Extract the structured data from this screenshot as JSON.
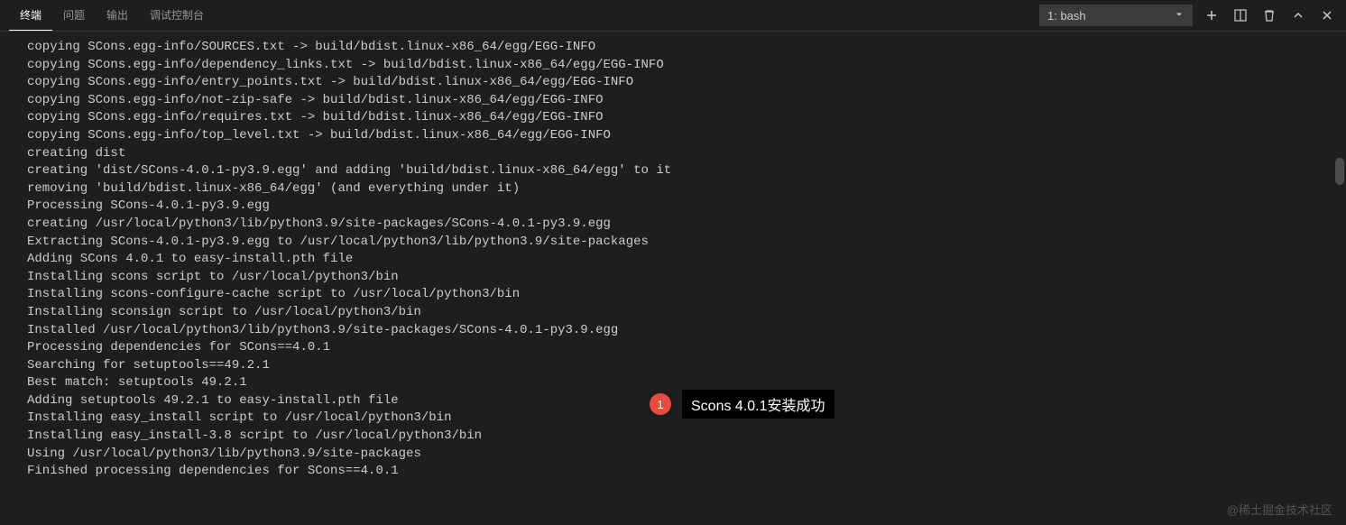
{
  "tabs": {
    "terminal": "终端",
    "problems": "问题",
    "output": "输出",
    "debug_console": "调试控制台"
  },
  "terminal_select": {
    "label": "1: bash"
  },
  "terminal_lines": [
    "copying SCons.egg-info/SOURCES.txt -> build/bdist.linux-x86_64/egg/EGG-INFO",
    "copying SCons.egg-info/dependency_links.txt -> build/bdist.linux-x86_64/egg/EGG-INFO",
    "copying SCons.egg-info/entry_points.txt -> build/bdist.linux-x86_64/egg/EGG-INFO",
    "copying SCons.egg-info/not-zip-safe -> build/bdist.linux-x86_64/egg/EGG-INFO",
    "copying SCons.egg-info/requires.txt -> build/bdist.linux-x86_64/egg/EGG-INFO",
    "copying SCons.egg-info/top_level.txt -> build/bdist.linux-x86_64/egg/EGG-INFO",
    "creating dist",
    "creating 'dist/SCons-4.0.1-py3.9.egg' and adding 'build/bdist.linux-x86_64/egg' to it",
    "removing 'build/bdist.linux-x86_64/egg' (and everything under it)",
    "Processing SCons-4.0.1-py3.9.egg",
    "creating /usr/local/python3/lib/python3.9/site-packages/SCons-4.0.1-py3.9.egg",
    "Extracting SCons-4.0.1-py3.9.egg to /usr/local/python3/lib/python3.9/site-packages",
    "Adding SCons 4.0.1 to easy-install.pth file",
    "Installing scons script to /usr/local/python3/bin",
    "Installing scons-configure-cache script to /usr/local/python3/bin",
    "Installing sconsign script to /usr/local/python3/bin",
    "",
    "Installed /usr/local/python3/lib/python3.9/site-packages/SCons-4.0.1-py3.9.egg",
    "Processing dependencies for SCons==4.0.1",
    "Searching for setuptools==49.2.1",
    "Best match: setuptools 49.2.1",
    "Adding setuptools 49.2.1 to easy-install.pth file",
    "Installing easy_install script to /usr/local/python3/bin",
    "Installing easy_install-3.8 script to /usr/local/python3/bin",
    "",
    "Using /usr/local/python3/lib/python3.9/site-packages",
    "Finished processing dependencies for SCons==4.0.1"
  ],
  "annotation": {
    "number": "1",
    "text": "Scons 4.0.1安装成功"
  },
  "watermark": "@稀土掘金技术社区"
}
